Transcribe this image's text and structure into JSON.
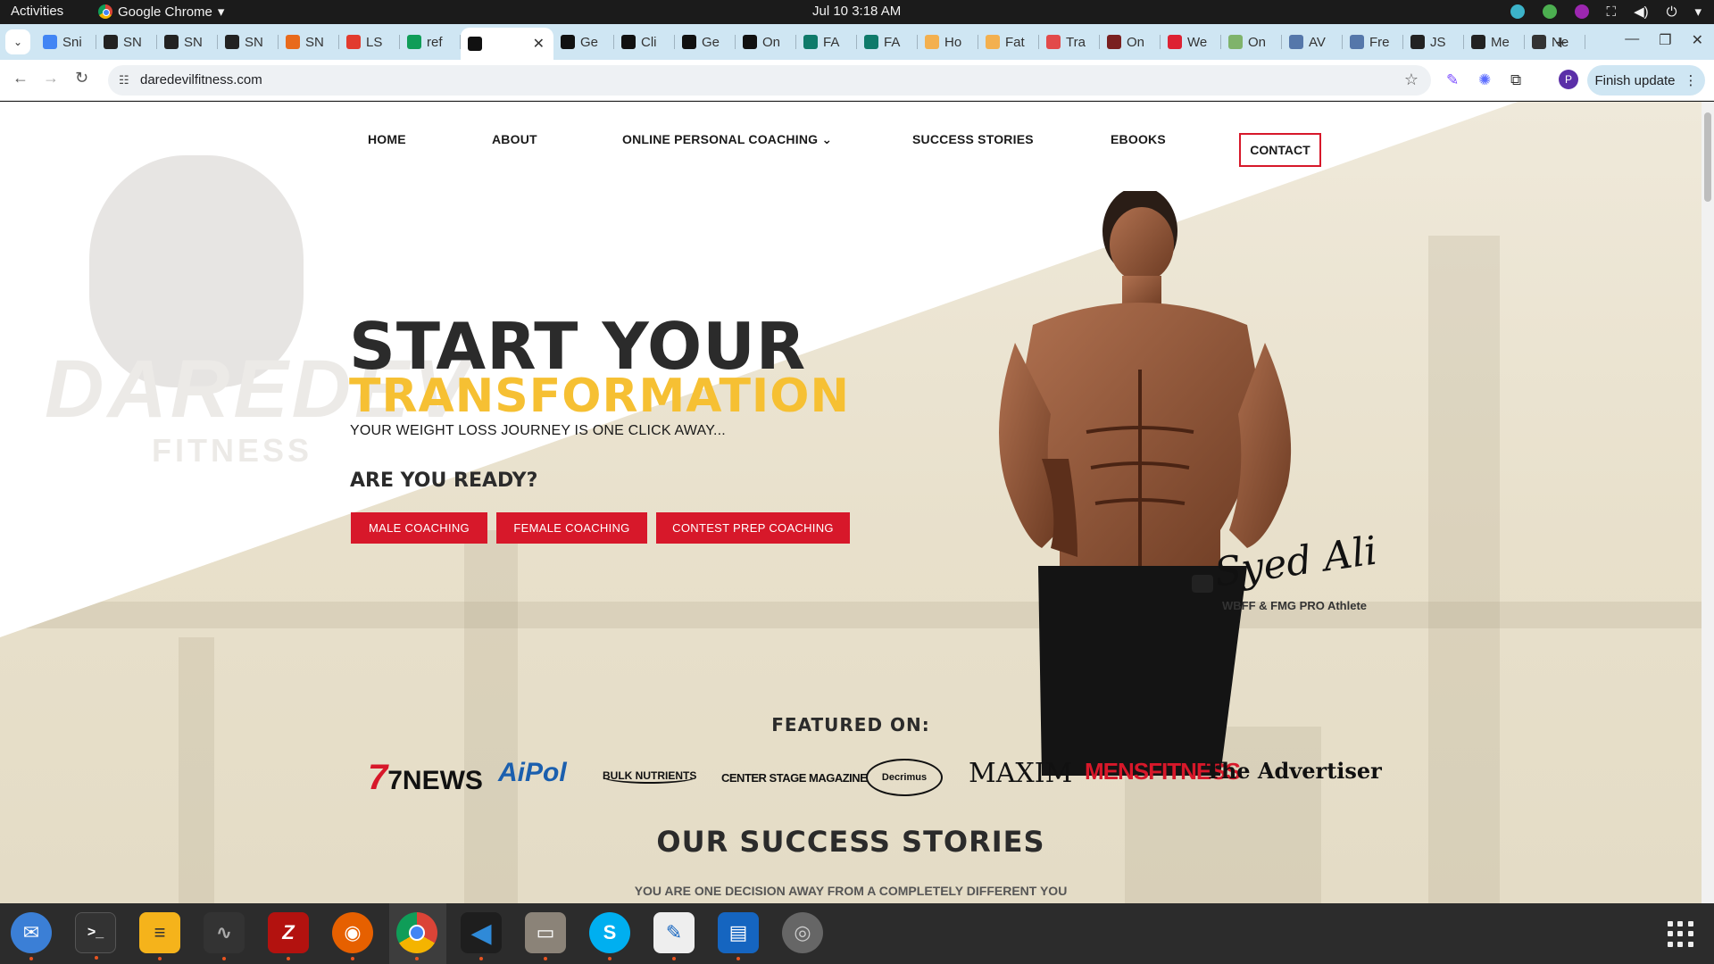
{
  "topbar": {
    "activities": "Activities",
    "app_name": "Google Chrome",
    "clock": "Jul 10  3:18 AM"
  },
  "tabs": [
    {
      "label": "Sni",
      "icon": "docs-icon",
      "color": "#4285f4"
    },
    {
      "label": "SN",
      "icon": "snp-icon",
      "color": "#222"
    },
    {
      "label": "SN",
      "icon": "snp-icon",
      "color": "#222"
    },
    {
      "label": "SN",
      "icon": "snp-icon",
      "color": "#222"
    },
    {
      "label": "SN",
      "icon": "orange-icon",
      "color": "#e86a1c"
    },
    {
      "label": "LS",
      "icon": "ls-icon",
      "color": "#e23b2e"
    },
    {
      "label": "ref",
      "icon": "sheets-icon",
      "color": "#0f9d58"
    },
    {
      "label": "",
      "icon": "devil-icon",
      "color": "#111",
      "active": true
    },
    {
      "label": "Ge",
      "icon": "devil-icon",
      "color": "#111"
    },
    {
      "label": "Cli",
      "icon": "devil-icon",
      "color": "#111"
    },
    {
      "label": "Ge",
      "icon": "devil-icon",
      "color": "#111"
    },
    {
      "label": "On",
      "icon": "devil-icon",
      "color": "#111"
    },
    {
      "label": "FA",
      "icon": "fa-icon",
      "color": "#0f7a6a"
    },
    {
      "label": "FA",
      "icon": "fa-icon",
      "color": "#0f7a6a"
    },
    {
      "label": "Ho",
      "icon": "flame-icon",
      "color": "#f3b04f"
    },
    {
      "label": "Fat",
      "icon": "flame-icon",
      "color": "#f3b04f"
    },
    {
      "label": "Tra",
      "icon": "heart-icon",
      "color": "#e24a4a"
    },
    {
      "label": "On",
      "icon": "person-icon",
      "color": "#7a2020"
    },
    {
      "label": "We",
      "icon": "person-icon",
      "color": "#d23"
    },
    {
      "label": "On",
      "icon": "image-icon",
      "color": "#7fb36b"
    },
    {
      "label": "AV",
      "icon": "image-icon",
      "color": "#5577aa"
    },
    {
      "label": "Fre",
      "icon": "image-icon",
      "color": "#5577aa"
    },
    {
      "label": "JS",
      "icon": "shield-icon",
      "color": "#222"
    },
    {
      "label": "Me",
      "icon": "shield-icon",
      "color": "#222"
    },
    {
      "label": "Ne",
      "icon": "globe-icon",
      "color": "#333"
    }
  ],
  "address": {
    "url": "daredevilfitness.com",
    "finish_update": "Finish update",
    "profile_initial": "P"
  },
  "nav": {
    "home": "HOME",
    "about": "ABOUT",
    "coaching": "ONLINE PERSONAL COACHING",
    "success": "SUCCESS STORIES",
    "ebooks": "EBOOKS",
    "contact": "CONTACT"
  },
  "hero": {
    "line1": "START YOUR",
    "line2": "TRANSFORMATION",
    "subtitle": "YOUR WEIGHT LOSS JOURNEY IS ONE CLICK AWAY...",
    "question": "ARE YOU READY?",
    "btn_male": "MALE COACHING",
    "btn_female": "FEMALE COACHING",
    "btn_contest": "CONTEST PREP COACHING",
    "signature": "Syed Ali",
    "signature_sub": "WBFF & FMG PRO Athlete",
    "watermark": "DAREDEV",
    "watermark_sub": "FITNESS"
  },
  "featured": {
    "heading": "FEATURED ON:",
    "logos": [
      "7NEWS",
      "AiPol",
      "BULK NUTRIENTS",
      "CENTER STAGE MAGAZINE",
      "Decrimus",
      "MAXIM",
      "MENSFITNESS",
      "The Advertiser"
    ]
  },
  "success": {
    "heading": "OUR SUCCESS STORIES",
    "subheading": "YOU ARE ONE DECISION AWAY FROM A COMPLETELY DIFFERENT YOU"
  },
  "colors": {
    "accent_red": "#d7182a",
    "accent_yellow": "#f6c033",
    "heading_dark": "#2b2b2b"
  }
}
